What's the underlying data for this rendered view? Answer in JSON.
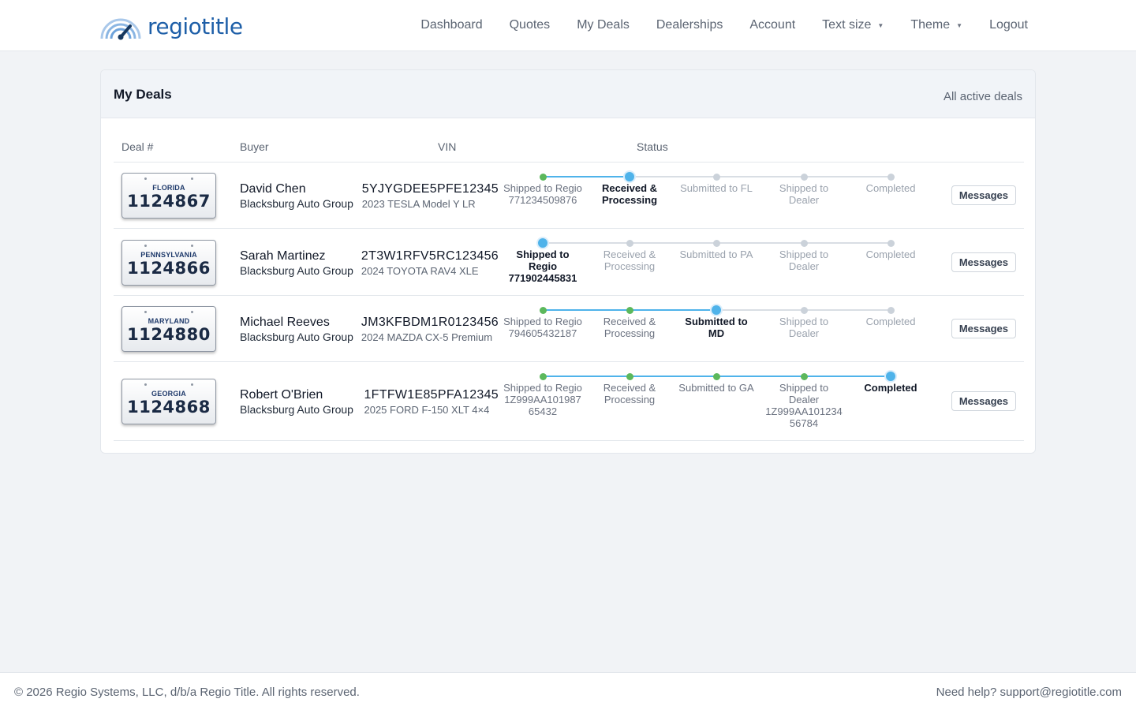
{
  "brand": {
    "name": "regiotitle"
  },
  "nav": {
    "items": [
      "Dashboard",
      "Quotes",
      "My Deals",
      "Dealerships",
      "Account"
    ],
    "text_size": "Text size",
    "theme": "Theme",
    "logout": "Logout"
  },
  "card": {
    "title": "My Deals",
    "filter": "All active deals"
  },
  "columns": {
    "deal": "Deal #",
    "buyer": "Buyer",
    "vin": "VIN",
    "status": "Status"
  },
  "deals": [
    {
      "state": "FLORIDA",
      "number": "1124867",
      "buyer": "David Chen",
      "dealer": "Blacksburg Auto Group",
      "vin": "5YJYGDEE5PFE12345",
      "vehicle": "2023 TESLA Model Y LR",
      "current_step": 1,
      "steps": [
        {
          "label": "Shipped to Regio",
          "tracking": "771234509876"
        },
        {
          "label": "Received & Processing",
          "tracking": ""
        },
        {
          "label": "Submitted to FL",
          "tracking": ""
        },
        {
          "label": "Shipped to Dealer",
          "tracking": ""
        },
        {
          "label": "Completed",
          "tracking": ""
        }
      ],
      "messages": "Messages"
    },
    {
      "state": "PENNSYLVANIA",
      "number": "1124866",
      "buyer": "Sarah Martinez",
      "dealer": "Blacksburg Auto Group",
      "vin": "2T3W1RFV5RC123456",
      "vehicle": "2024 TOYOTA RAV4 XLE",
      "current_step": 0,
      "steps": [
        {
          "label": "Shipped to Regio",
          "tracking": "771902445831"
        },
        {
          "label": "Received & Processing",
          "tracking": ""
        },
        {
          "label": "Submitted to PA",
          "tracking": ""
        },
        {
          "label": "Shipped to Dealer",
          "tracking": ""
        },
        {
          "label": "Completed",
          "tracking": ""
        }
      ],
      "messages": "Messages"
    },
    {
      "state": "MARYLAND",
      "number": "1124880",
      "buyer": "Michael Reeves",
      "dealer": "Blacksburg Auto Group",
      "vin": "JM3KFBDM1R0123456",
      "vehicle": "2024 MAZDA CX-5 Premium",
      "current_step": 2,
      "steps": [
        {
          "label": "Shipped to Regio",
          "tracking": "794605432187"
        },
        {
          "label": "Received & Processing",
          "tracking": ""
        },
        {
          "label": "Submitted to MD",
          "tracking": ""
        },
        {
          "label": "Shipped to Dealer",
          "tracking": ""
        },
        {
          "label": "Completed",
          "tracking": ""
        }
      ],
      "messages": "Messages"
    },
    {
      "state": "GEORGIA",
      "number": "1124868",
      "buyer": "Robert O'Brien",
      "dealer": "Blacksburg Auto Group",
      "vin": "1FTFW1E85PFA12345",
      "vehicle": "2025 FORD F-150 XLT 4×4",
      "current_step": 4,
      "steps": [
        {
          "label": "Shipped to Regio",
          "tracking": "1Z999AA101987 65432"
        },
        {
          "label": "Received & Processing",
          "tracking": ""
        },
        {
          "label": "Submitted to GA",
          "tracking": ""
        },
        {
          "label": "Shipped to Dealer",
          "tracking": "1Z999AA101234 56784"
        },
        {
          "label": "Completed",
          "tracking": ""
        }
      ],
      "messages": "Messages"
    }
  ],
  "colors": {
    "done": "#5cb85c",
    "current": "#4fb3ea",
    "pending": "#cbd2da",
    "done_line": "#4fb3ea",
    "pending_line": "#d9dee4"
  },
  "footer": {
    "copyright": "© 2026 Regio Systems, LLC, d/b/a Regio Title. All rights reserved.",
    "help": "Need help? support@regiotitle.com"
  }
}
